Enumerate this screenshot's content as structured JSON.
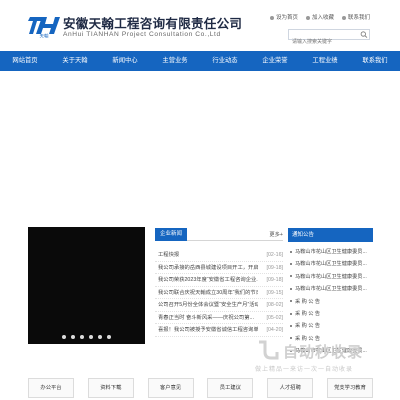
{
  "company": {
    "name_cn": "安徽天翰工程咨询有限责任公司",
    "name_en": "AnHui TIANHAN Project Consultation Co.,Ltd",
    "logo_text": "天翰"
  },
  "top_links": [
    "设为首页",
    "加入收藏",
    "联系我们"
  ],
  "search": {
    "placeholder": "请输入搜索关键字"
  },
  "nav": [
    "网站首页",
    "关于天翰",
    "新闻中心",
    "主营业务",
    "行业动态",
    "企业荣誉",
    "工程业绩",
    "联系我们"
  ],
  "news": {
    "tab": "企业新闻",
    "more": "更多+",
    "items": [
      {
        "title": "工程快报",
        "date": "[02-16]"
      },
      {
        "title": "我公司承接的岳西县城建设项目开工，开启马...",
        "date": "[09-18]"
      },
      {
        "title": "我公司荣获2023年度“安徽省工程咨询企业...",
        "date": "[09-18]"
      },
      {
        "title": "我公司联合庆祝天翰成立30周年“我们的节日——...",
        "date": "[09-15]"
      },
      {
        "title": "公司召开5月份全体会议暨“安全生产月”活动...",
        "date": "[08-02]"
      },
      {
        "title": "青春正当时 奋斗新风采——庆祝公司第...",
        "date": "[05-02]"
      },
      {
        "title": "喜报！我公司被授予安徽省诚信工程咨询单位...",
        "date": "[04-20]"
      }
    ]
  },
  "notice": {
    "title": "通知公告",
    "items": [
      "马鞍山市花山区卫生健康委员...",
      "马鞍山市花山区卫生健康委员...",
      "马鞍山市花山区卫生健康委员...",
      "马鞍山市花山区卫生健康委员...",
      "采 购 公 告",
      "采 购 公 告",
      "采 购 公 告",
      "采 购 公 告",
      "马鞍山市花山区卫生健康委员..."
    ]
  },
  "quick_links": [
    "办公平台",
    "资料下载",
    "客户意见",
    "员工建议",
    "人才招聘",
    "党支学习教育"
  ],
  "watermark": {
    "title": "自动秒收录",
    "sub": "做上精品一来访一次一自动收录"
  },
  "colors": {
    "primary": "#1565c0",
    "nav_text": "#ffffff"
  },
  "slider": {
    "dots": 6
  }
}
